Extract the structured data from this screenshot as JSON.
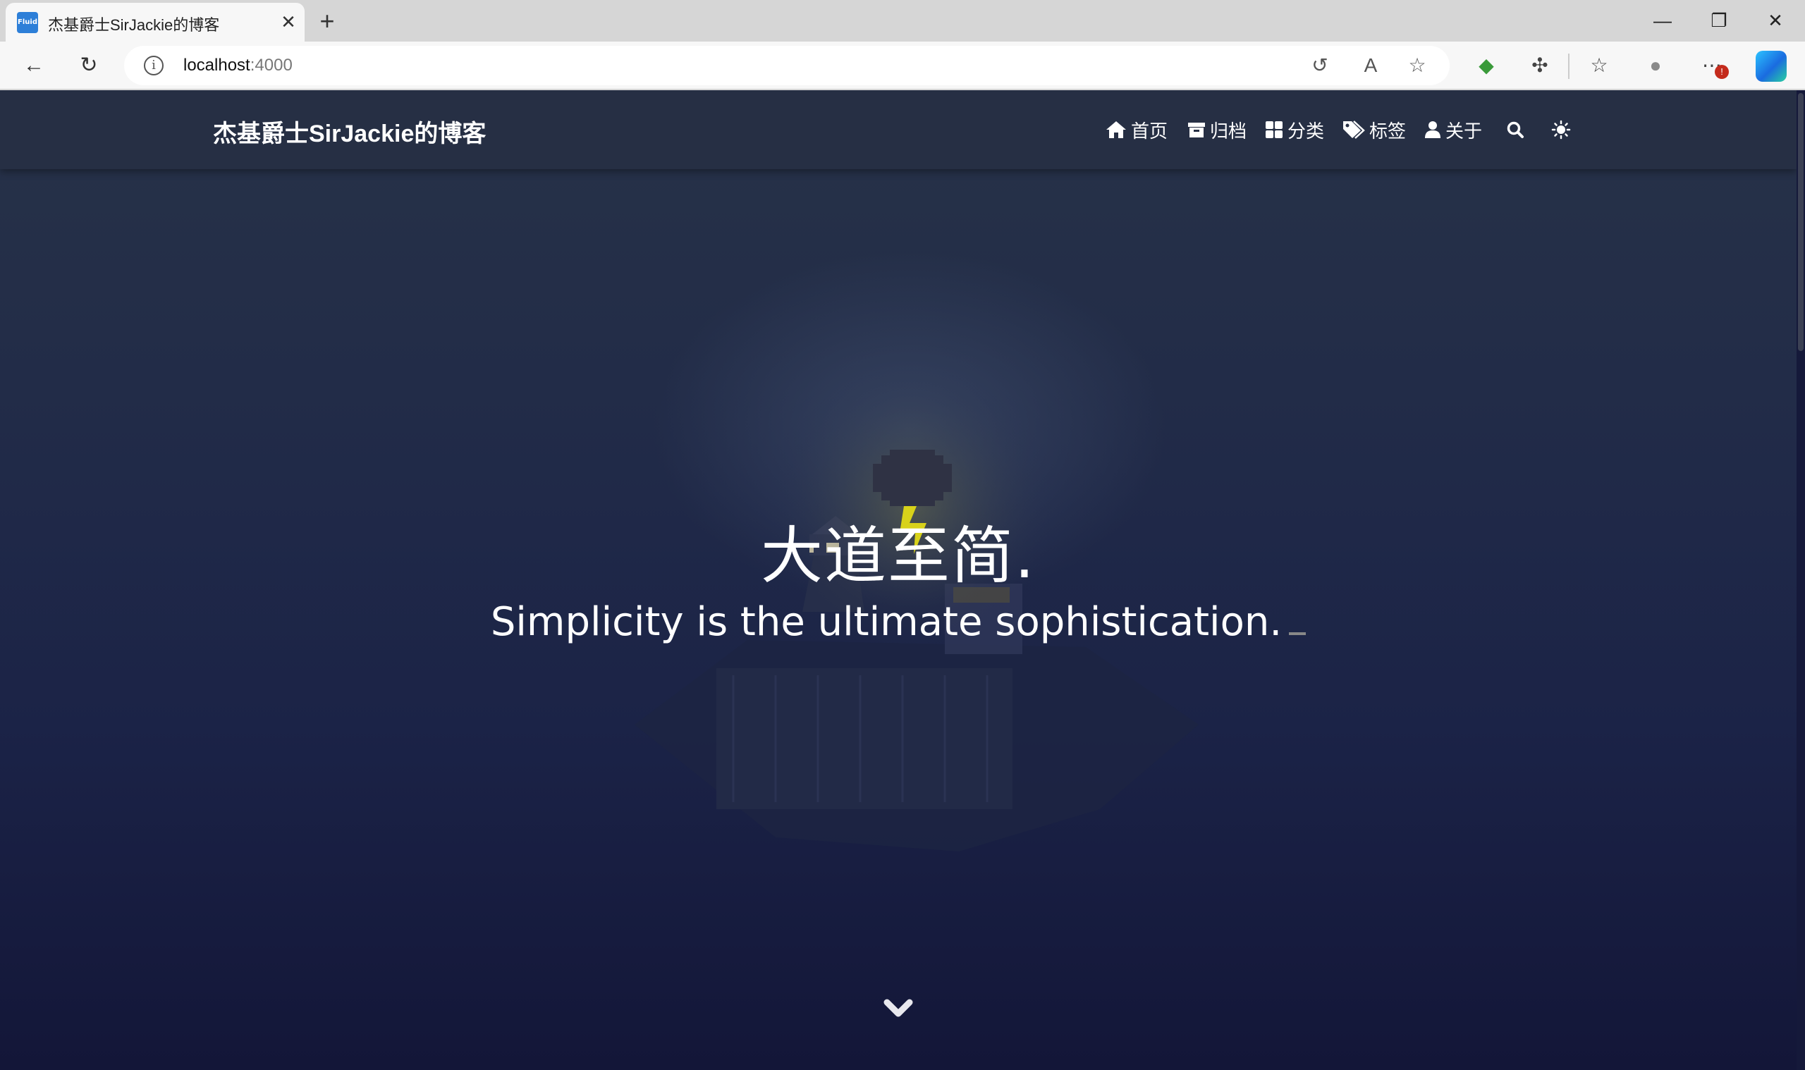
{
  "browser": {
    "tab": {
      "title": "杰基爵士SirJackie的博客",
      "favicon_text": "Fluid"
    },
    "address": {
      "host": "localhost",
      "port": ":4000"
    }
  },
  "site": {
    "brand": "杰基爵士SirJackie的博客",
    "nav": [
      {
        "label": "首页",
        "icon": "home-icon"
      },
      {
        "label": "归档",
        "icon": "archive-icon"
      },
      {
        "label": "分类",
        "icon": "category-icon"
      },
      {
        "label": "标签",
        "icon": "tag-icon"
      },
      {
        "label": "关于",
        "icon": "user-icon"
      }
    ]
  },
  "hero": {
    "title": "大道至简.",
    "subtitle": "Simplicity is the ultimate sophistication."
  },
  "colors": {
    "accent_lightning": "#d8d21a",
    "navbar_bg": "#262f44",
    "hero_bottom": "#131638"
  }
}
